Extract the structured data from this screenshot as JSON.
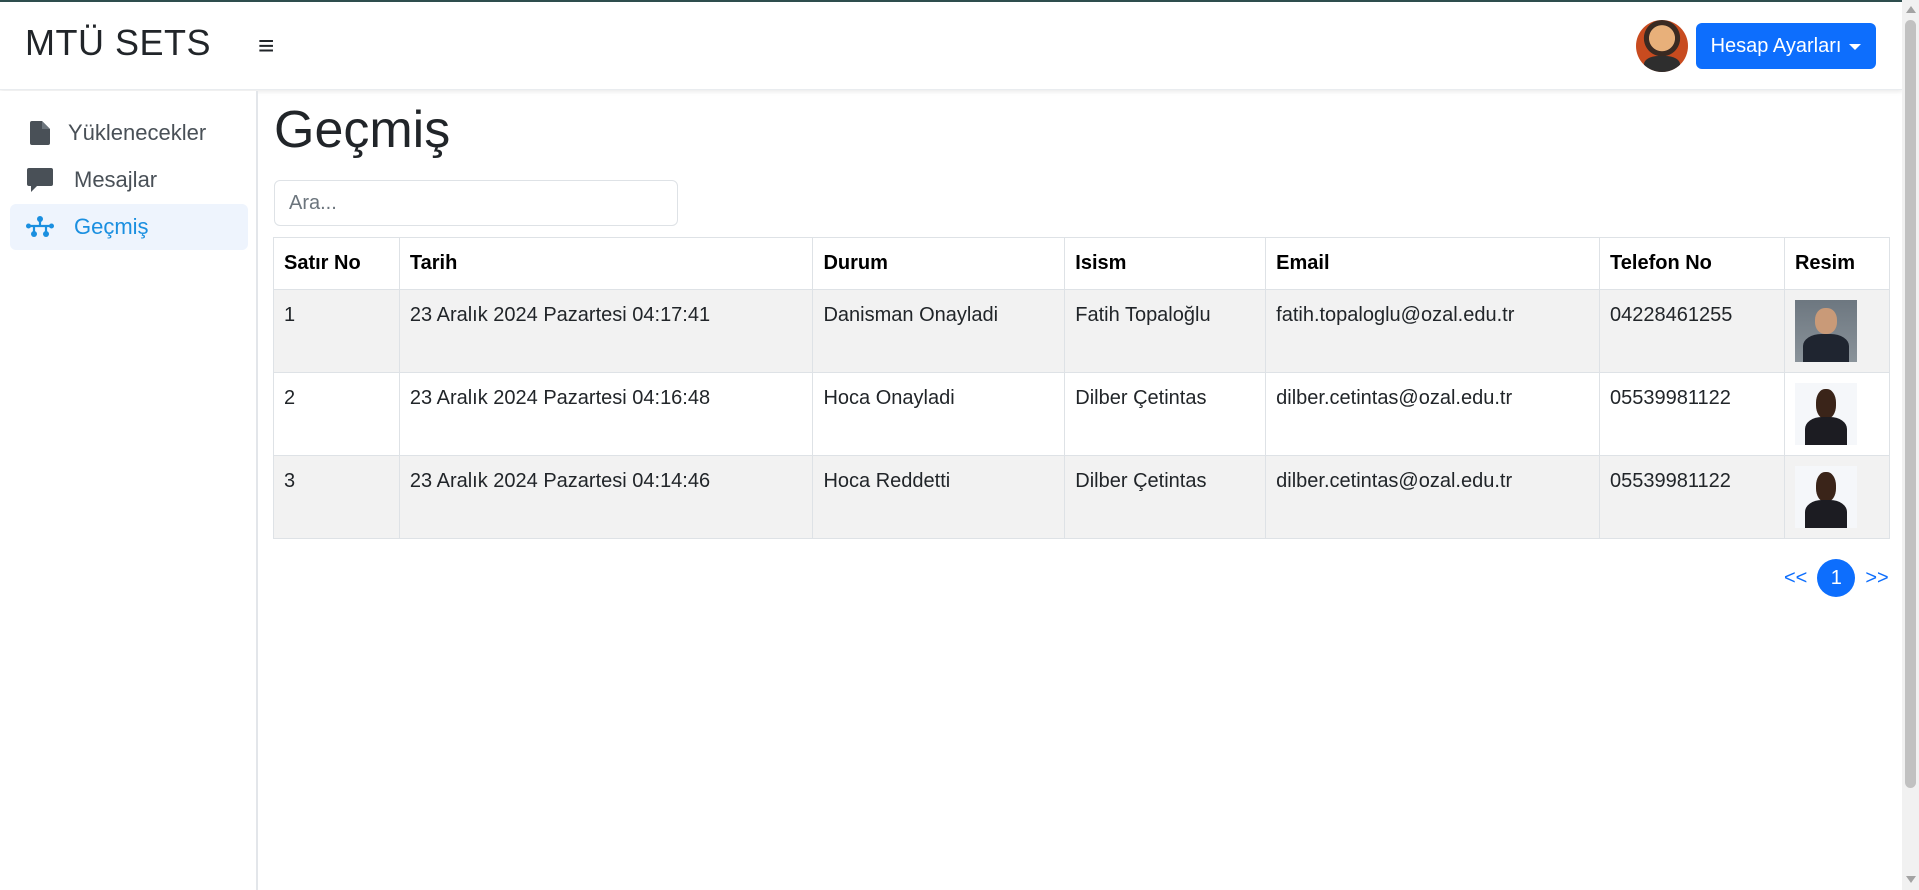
{
  "header": {
    "brand": "MTÜ SETS",
    "menu_icon": "hamburger-icon",
    "account_button": "Hesap Ayarları",
    "accent_color": "#0d6efd"
  },
  "sidebar": {
    "items": [
      {
        "label": "Yüklenecekler",
        "icon": "file-icon",
        "active": false
      },
      {
        "label": "Mesajlar",
        "icon": "message-icon",
        "active": false
      },
      {
        "label": "Geçmiş",
        "icon": "history-network-icon",
        "active": true
      }
    ]
  },
  "main": {
    "title": "Geçmiş",
    "search": {
      "placeholder": "Ara...",
      "value": ""
    },
    "table": {
      "headers": [
        "Satır No",
        "Tarih",
        "Durum",
        "Isism",
        "Email",
        "Telefon No",
        "Resim"
      ],
      "rows": [
        {
          "no": "1",
          "date": "23 Aralık 2024 Pazartesi 04:17:41",
          "status": "Danisman Onayladi",
          "name": "Fatih Topaloğlu",
          "email": "fatih.topaloglu@ozal.edu.tr",
          "phone": "04228461255"
        },
        {
          "no": "2",
          "date": "23 Aralık 2024 Pazartesi 04:16:48",
          "status": "Hoca Onayladi",
          "name": "Dilber Çetintas",
          "email": "dilber.cetintas@ozal.edu.tr",
          "phone": "05539981122"
        },
        {
          "no": "3",
          "date": "23 Aralık 2024 Pazartesi 04:14:46",
          "status": "Hoca Reddetti",
          "name": "Dilber Çetintas",
          "email": "dilber.cetintas@ozal.edu.tr",
          "phone": "05539981122"
        }
      ]
    },
    "pagination": {
      "prev": "<<",
      "current": "1",
      "next": ">>"
    }
  }
}
